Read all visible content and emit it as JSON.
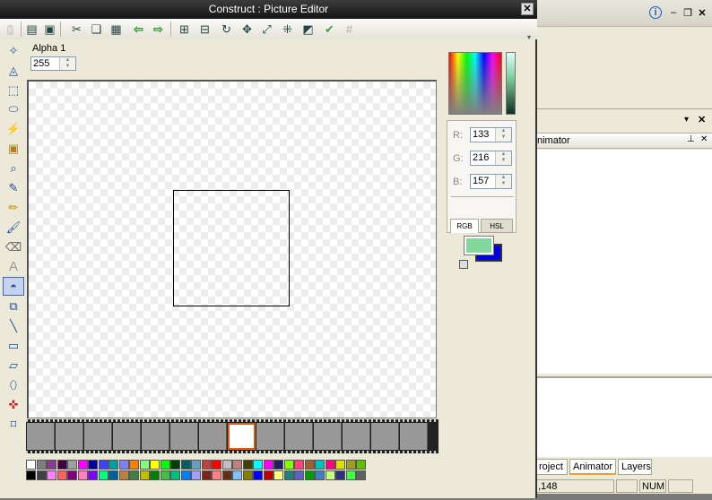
{
  "editor": {
    "title": "Construct : Picture Editor",
    "close_label": "✕",
    "alpha_label": "Alpha 1",
    "alpha_value": "255",
    "toolbar_icons": [
      "new-icon",
      "open-icon",
      "save-icon",
      "cut-icon",
      "copy-icon",
      "paste-icon",
      "undo-icon",
      "redo-icon",
      "resize-canvas-icon",
      "crop-icon",
      "rotate-icon",
      "flip-icon",
      "stretch-icon",
      "hotspot-icon",
      "invert-icon",
      "apply-icon",
      "grid-icon"
    ],
    "tools": [
      "lasso-icon",
      "polygon-select-icon",
      "rect-select-icon",
      "ellipse-select-icon",
      "magic-wand-icon",
      "image-icon",
      "zoom-icon",
      "eyedropper-icon",
      "pencil-icon",
      "brush-icon",
      "eraser-icon",
      "text-icon",
      "fill-icon",
      "clone-icon",
      "line-icon",
      "rectangle-icon",
      "parallelogram-icon",
      "ellipse-icon",
      "hotspot-tool-icon",
      "action-point-icon"
    ],
    "selected_tool_index": 12
  },
  "color": {
    "r_label": "R:",
    "g_label": "G:",
    "b_label": "B:",
    "r": "133",
    "g": "216",
    "b": "157",
    "tab_rgb": "RGB",
    "tab_hsl": "HSL",
    "foreground": "#85d89d",
    "background": "#0000e0"
  },
  "filmstrip": {
    "frame_count": 14,
    "current_frame": 7
  },
  "palette": [
    "#ffffff",
    "#000000",
    "#7f7f7f",
    "#404040",
    "#8a3c90",
    "#ff80ff",
    "#400040",
    "#ff6060",
    "#a0a0a0",
    "#800080",
    "#ff00ff",
    "#ff80c0",
    "#0000a0",
    "#8000ff",
    "#4040ff",
    "#00ff80",
    "#00a0a0",
    "#0060a0",
    "#8080ff",
    "#c08040",
    "#ff8000",
    "#408040",
    "#80ff80",
    "#c0c000",
    "#ffff00",
    "#008000",
    "#00ff00",
    "#40c040",
    "#004000",
    "#00c080",
    "#006060",
    "#0080ff",
    "#60a0c0",
    "#a0a0ff",
    "#c04040",
    "#802020",
    "#ff0000",
    "#ff8080",
    "#c0c0c0",
    "#603010",
    "#c08080",
    "#80c0ff",
    "#404000",
    "#808000",
    "#00ffff",
    "#0000ff",
    "#ff00ff",
    "#c00000",
    "#202060",
    "#ffff80",
    "#80ff00",
    "#208080",
    "#ff4080",
    "#6060c0",
    "#a06030",
    "#00a000",
    "#00c0c0",
    "#4080c0",
    "#ff0080",
    "#c0ff80",
    "#e0e000",
    "#303080",
    "#a0a020",
    "#40ff40",
    "#60c000",
    "#606060"
  ],
  "background_app": {
    "panel_title": "nimator",
    "tabs": [
      "roject",
      "Animator",
      "Layers"
    ],
    "status_coord": ",148",
    "status_num": "NUM"
  }
}
